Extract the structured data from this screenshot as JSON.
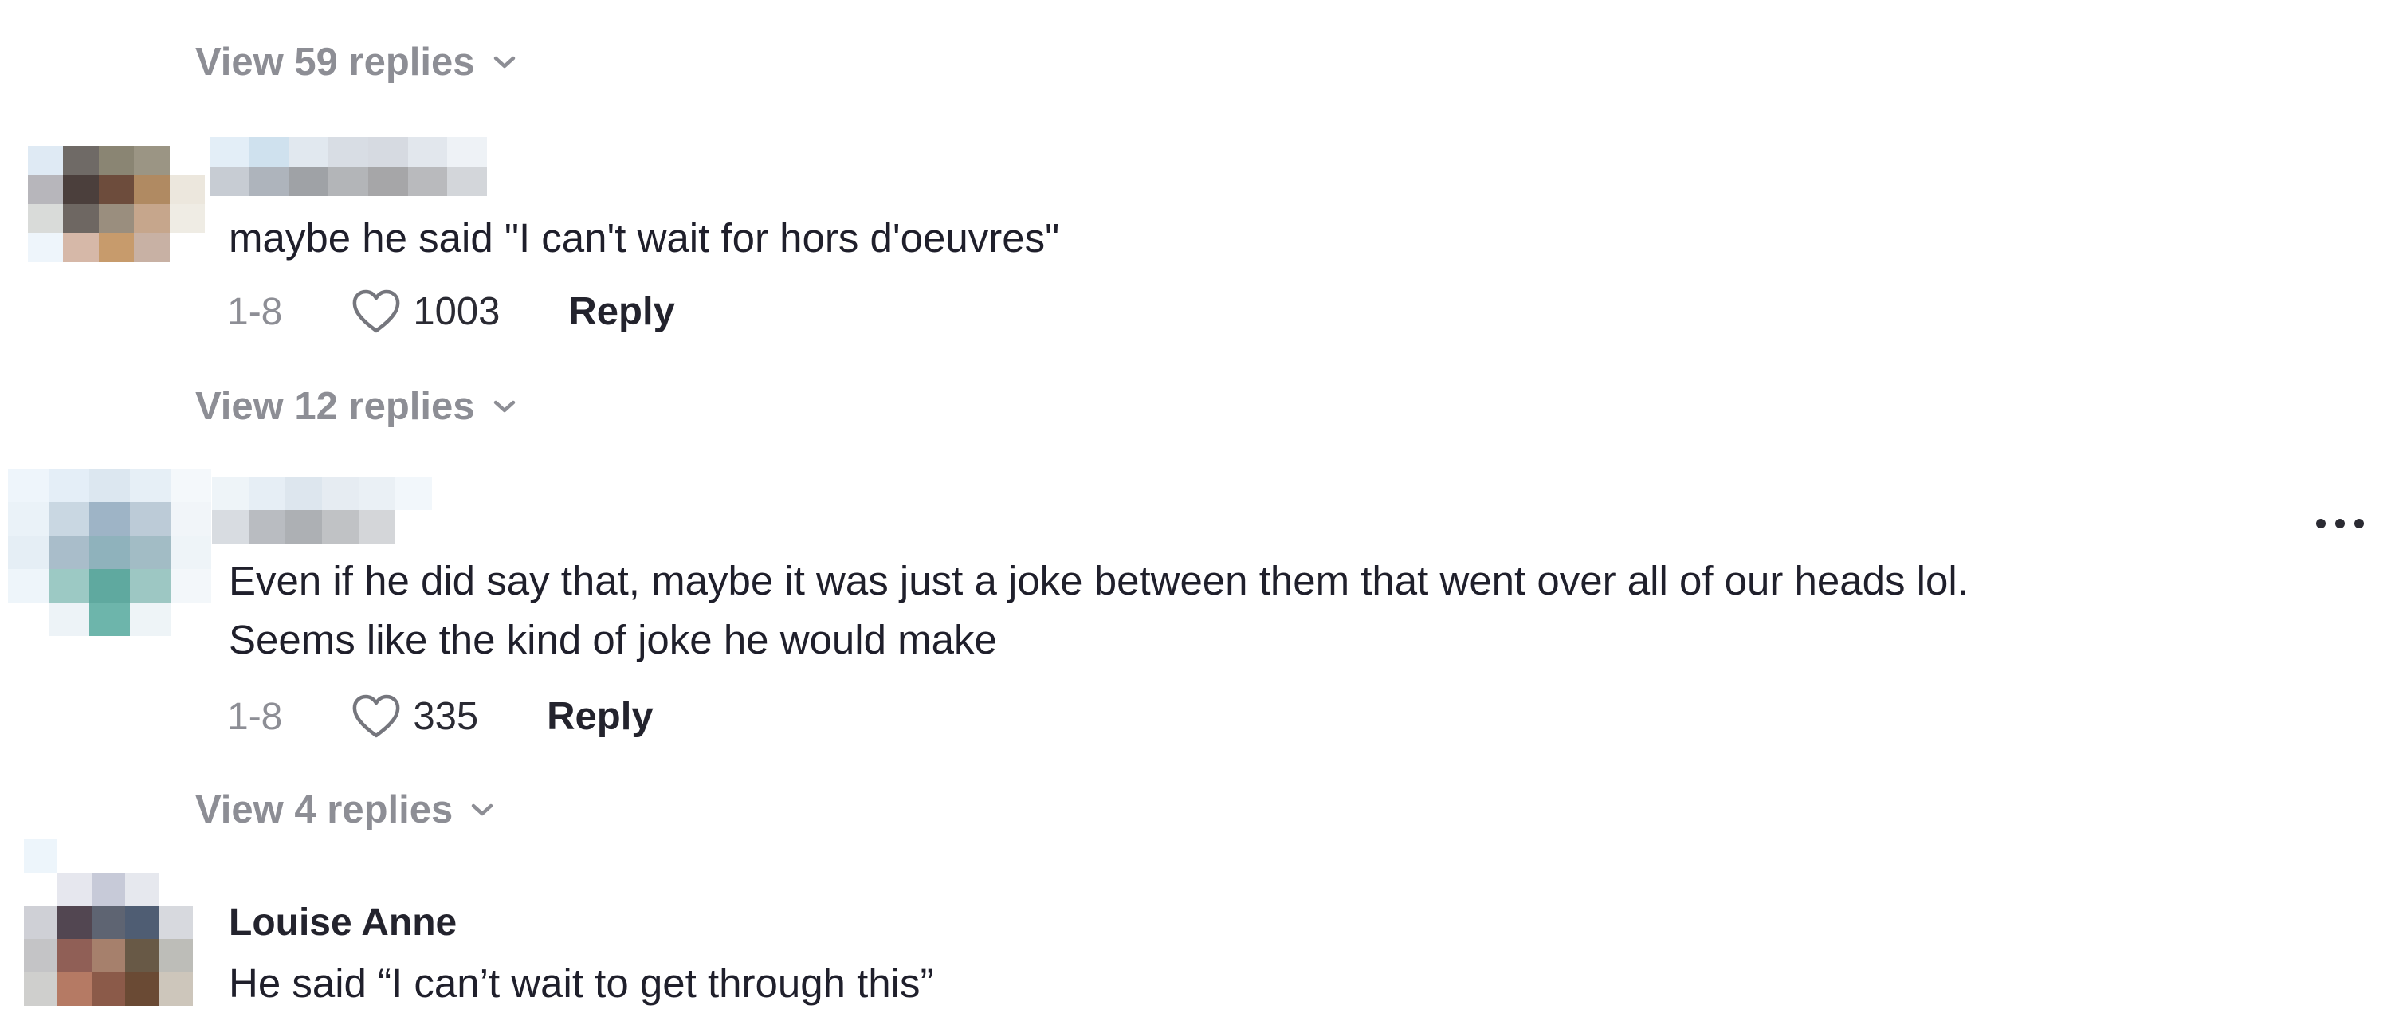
{
  "thread": {
    "top_view_replies": {
      "label": "View 59 replies"
    },
    "comments": [
      {
        "username": "",
        "text_lines": [
          "maybe he said \"I can't wait for hors d'oeuvres\""
        ],
        "date": "1-8",
        "likes": "1003",
        "reply_label": "Reply",
        "view_replies_label": "View 12 replies"
      },
      {
        "username": "",
        "text_lines": [
          "Even if he did say that, maybe it was just a joke between them that went over all of our heads lol.",
          "Seems like the kind of joke he would make"
        ],
        "date": "1-8",
        "likes": "335",
        "reply_label": "Reply",
        "view_replies_label": "View 4 replies"
      },
      {
        "username": "Louise Anne",
        "text_lines": [
          "He said “I can’t wait to get through this”"
        ]
      }
    ]
  },
  "colors": {
    "text_primary": "#1f1f2b",
    "text_muted": "#8d8e95",
    "background": "#ffffff"
  },
  "icons": {
    "view_replies_chevron": "chevron-down-icon",
    "like": "heart-outline-icon",
    "more": "more-horizontal-icon"
  }
}
